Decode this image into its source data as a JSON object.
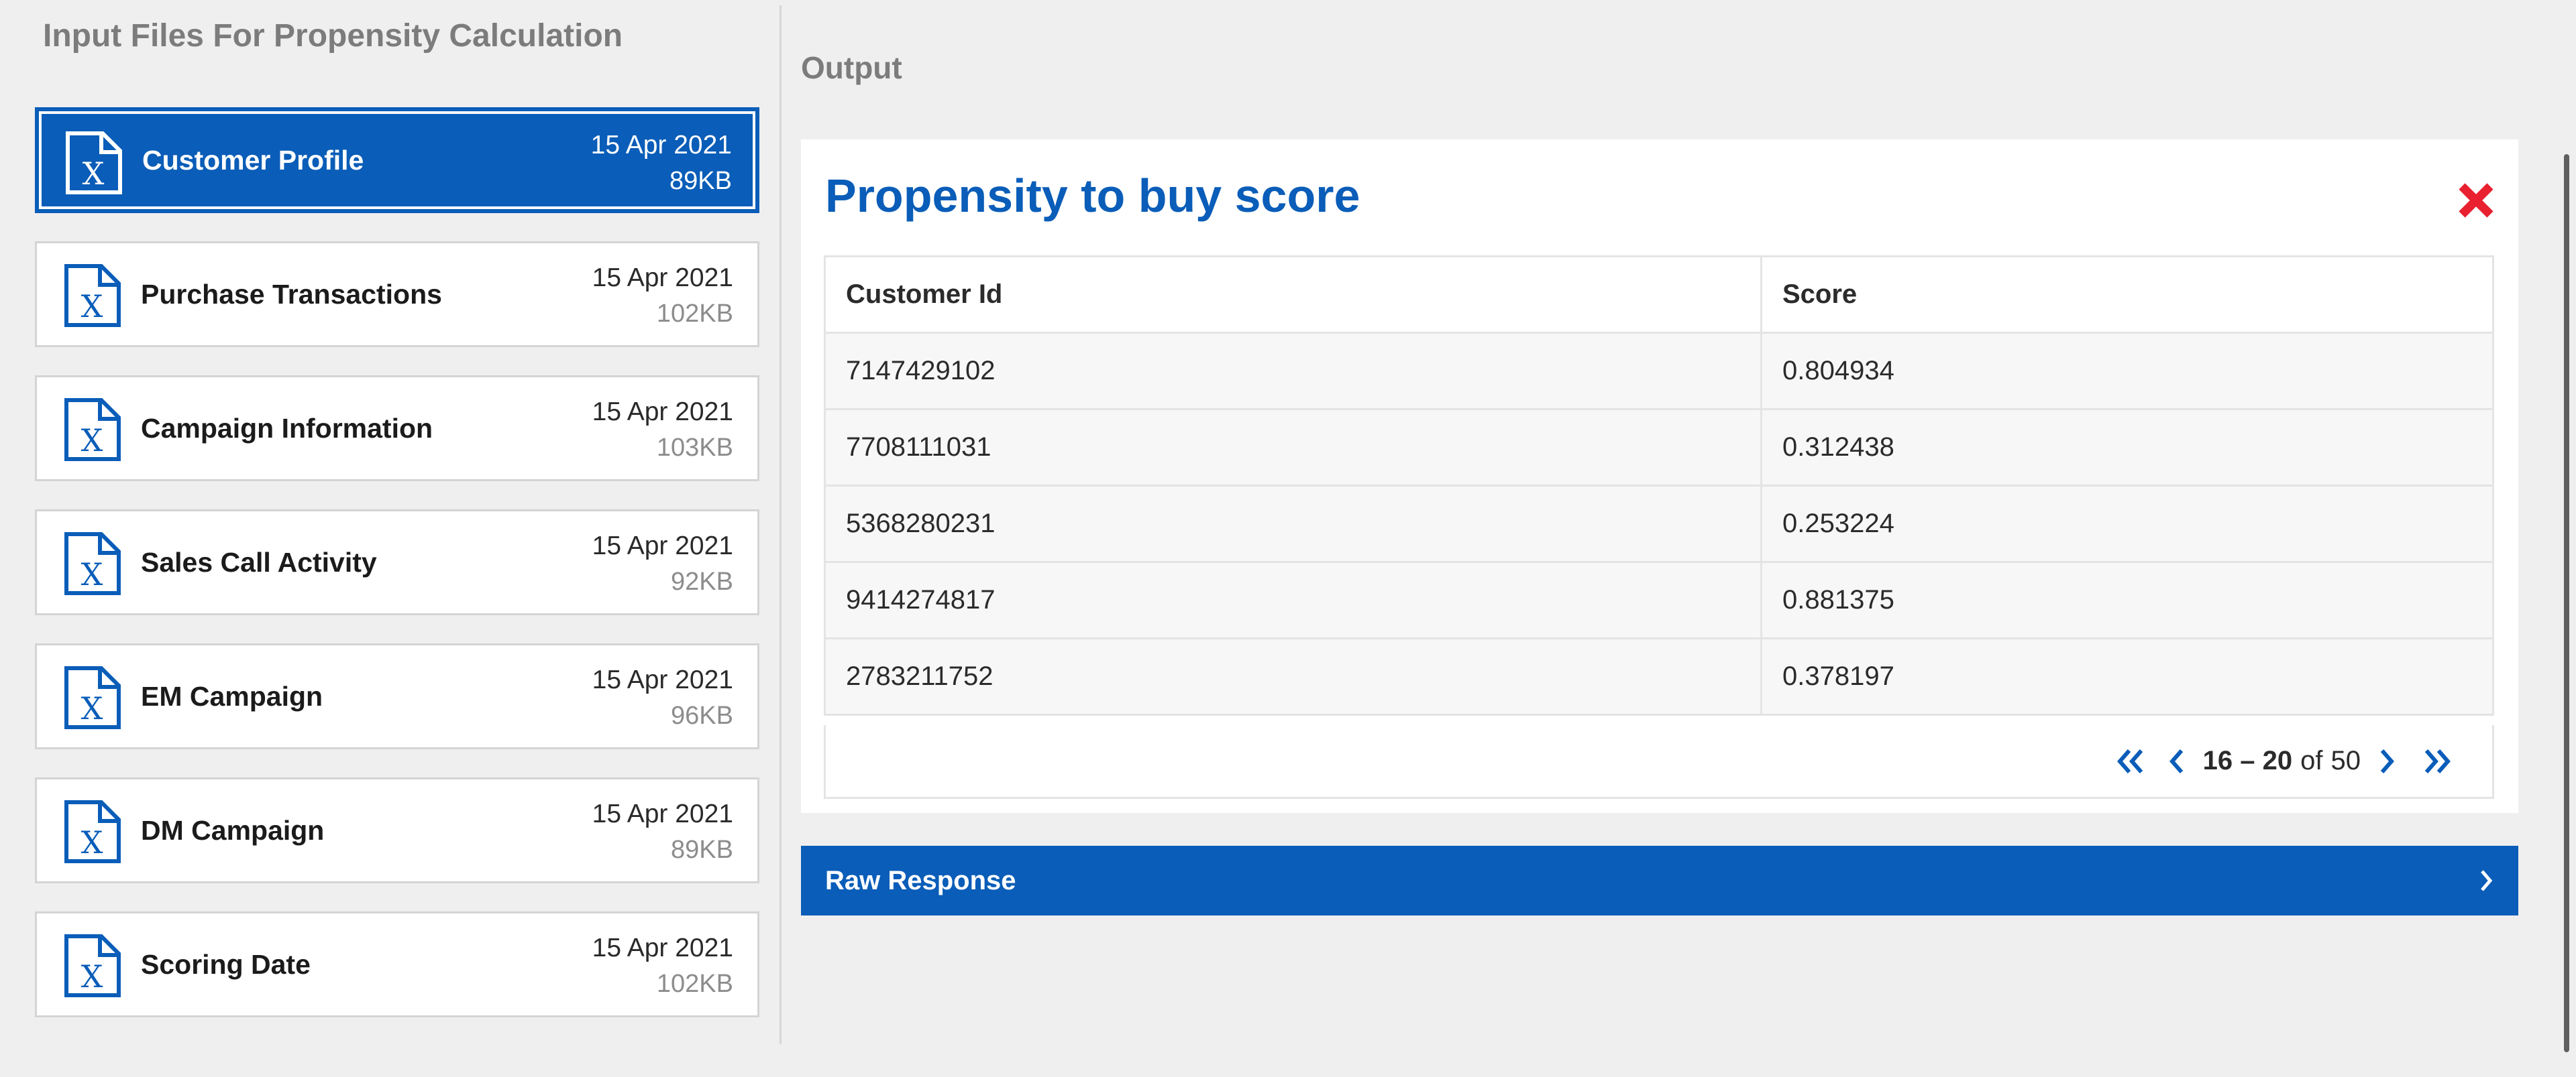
{
  "left_panel": {
    "title": "Input Files For Propensity Calculation",
    "files": [
      {
        "name": "Customer Profile",
        "date": "15 Apr 2021",
        "size": "89KB",
        "selected": true
      },
      {
        "name": "Purchase Transactions",
        "date": "15 Apr 2021",
        "size": "102KB",
        "selected": false
      },
      {
        "name": "Campaign Information",
        "date": "15 Apr 2021",
        "size": "103KB",
        "selected": false
      },
      {
        "name": "Sales Call Activity",
        "date": "15 Apr 2021",
        "size": "92KB",
        "selected": false
      },
      {
        "name": "EM Campaign",
        "date": "15 Apr 2021",
        "size": "96KB",
        "selected": false
      },
      {
        "name": "DM Campaign",
        "date": "15 Apr 2021",
        "size": "89KB",
        "selected": false
      },
      {
        "name": "Scoring Date",
        "date": "15 Apr 2021",
        "size": "102KB",
        "selected": false
      }
    ],
    "file_icon": "excel-file-icon"
  },
  "output": {
    "section_title": "Output",
    "card_title": "Propensity to buy score",
    "close_icon": "close-icon",
    "table": {
      "columns": [
        "Customer Id",
        "Score"
      ],
      "rows": [
        [
          "7147429102",
          "0.804934"
        ],
        [
          "7708111031",
          "0.312438"
        ],
        [
          "5368280231",
          "0.253224"
        ],
        [
          "9414274817",
          "0.881375"
        ],
        [
          "2783211752",
          "0.378197"
        ]
      ]
    },
    "pagination": {
      "range": "16 – 20",
      "of_label": "of",
      "total": "50"
    },
    "raw_response": {
      "label": "Raw Response",
      "icon": "chevron-right-icon"
    }
  },
  "colors": {
    "primary": "#0a5db8",
    "close": "#e8202f",
    "background": "#efefef"
  }
}
